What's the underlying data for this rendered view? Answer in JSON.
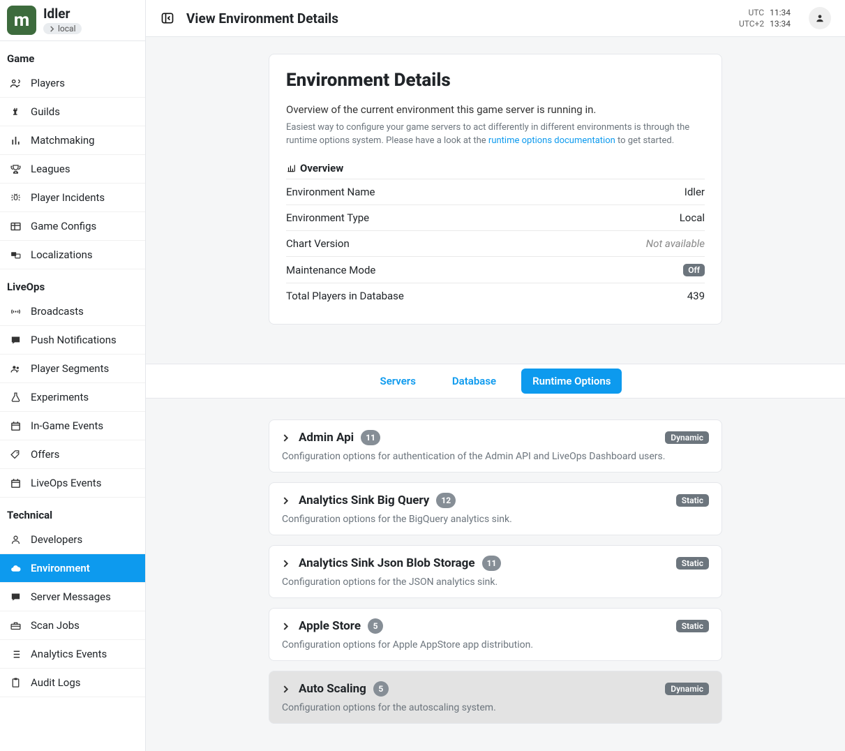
{
  "sidebar": {
    "appName": "Idler",
    "envTag": "local",
    "sections": [
      {
        "label": "Game",
        "items": [
          {
            "icon": "users",
            "label": "Players"
          },
          {
            "icon": "chess-rook",
            "label": "Guilds"
          },
          {
            "icon": "ranking",
            "label": "Matchmaking"
          },
          {
            "icon": "trophy",
            "label": "Leagues"
          },
          {
            "icon": "bug",
            "label": "Player Incidents"
          },
          {
            "icon": "table",
            "label": "Game Configs"
          },
          {
            "icon": "language",
            "label": "Localizations"
          }
        ]
      },
      {
        "label": "LiveOps",
        "items": [
          {
            "icon": "broadcast",
            "label": "Broadcasts"
          },
          {
            "icon": "message",
            "label": "Push Notifications"
          },
          {
            "icon": "user-group",
            "label": "Player Segments"
          },
          {
            "icon": "flask",
            "label": "Experiments"
          },
          {
            "icon": "calendar",
            "label": "In-Game Events"
          },
          {
            "icon": "tags",
            "label": "Offers"
          },
          {
            "icon": "calendar",
            "label": "LiveOps Events"
          }
        ]
      },
      {
        "label": "Technical",
        "items": [
          {
            "icon": "user",
            "label": "Developers"
          },
          {
            "icon": "cloud",
            "label": "Environment",
            "active": true
          },
          {
            "icon": "message",
            "label": "Server Messages"
          },
          {
            "icon": "toolbox",
            "label": "Scan Jobs"
          },
          {
            "icon": "list",
            "label": "Analytics Events"
          },
          {
            "icon": "clipboard",
            "label": "Audit Logs"
          }
        ]
      }
    ]
  },
  "header": {
    "title": "View Environment Details",
    "clocks": [
      {
        "label": "UTC",
        "time": "11:34"
      },
      {
        "label": "UTC+2",
        "time": "13:34"
      }
    ]
  },
  "envDetails": {
    "heading": "Environment Details",
    "subtitle": "Overview of the current environment this game server is running in.",
    "hintPrefix": "Easiest way to configure your game servers to act differently in different environments is through the runtime options system. Please have a look at the ",
    "hintLink": "runtime options documentation",
    "hintSuffix": " to get started.",
    "overviewLabel": "Overview",
    "rows": [
      {
        "k": "Environment Name",
        "v": "Idler"
      },
      {
        "k": "Environment Type",
        "v": "Local"
      },
      {
        "k": "Chart Version",
        "v": "Not available",
        "muted": true
      },
      {
        "k": "Maintenance Mode",
        "v": "Off",
        "pill": true
      },
      {
        "k": "Total Players in Database",
        "v": "439"
      }
    ]
  },
  "tabs": [
    {
      "label": "Servers"
    },
    {
      "label": "Database"
    },
    {
      "label": "Runtime Options",
      "active": true
    }
  ],
  "options": [
    {
      "title": "Admin Api",
      "count": "11",
      "kind": "Dynamic",
      "desc": "Configuration options for authentication of the Admin API and LiveOps Dashboard users."
    },
    {
      "title": "Analytics Sink Big Query",
      "count": "12",
      "kind": "Static",
      "desc": "Configuration options for the BigQuery analytics sink."
    },
    {
      "title": "Analytics Sink Json Blob Storage",
      "count": "11",
      "kind": "Static",
      "desc": "Configuration options for the JSON analytics sink."
    },
    {
      "title": "Apple Store",
      "count": "5",
      "kind": "Static",
      "desc": "Configuration options for Apple AppStore app distribution."
    },
    {
      "title": "Auto Scaling",
      "count": "5",
      "kind": "Dynamic",
      "desc": "Configuration options for the autoscaling system.",
      "hover": true
    }
  ]
}
